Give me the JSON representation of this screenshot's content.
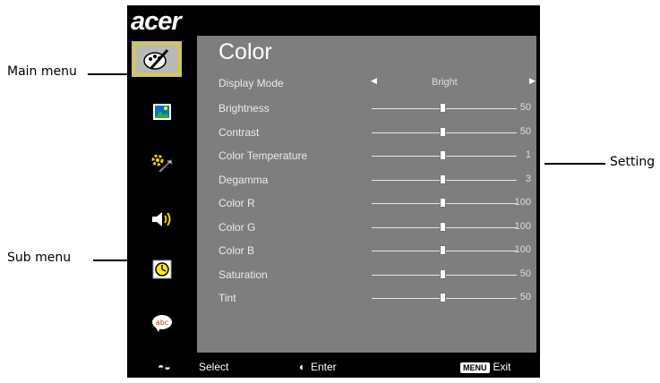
{
  "callouts": {
    "main_menu": "Main menu",
    "sub_menu": "Sub menu",
    "setting": "Setting"
  },
  "osd": {
    "logo": "acer",
    "sidebar": [
      "color-icon",
      "image-icon",
      "settings-icon",
      "audio-icon",
      "timer-icon",
      "language-icon"
    ],
    "title": "Color",
    "display_mode": {
      "label": "Display Mode",
      "value": "Bright"
    },
    "rows": [
      {
        "label": "Brightness",
        "value": "50"
      },
      {
        "label": "Contrast",
        "value": "50"
      },
      {
        "label": "Color Temperature",
        "value": "1"
      },
      {
        "label": "Degamma",
        "value": "3"
      },
      {
        "label": "Color R",
        "value": "100"
      },
      {
        "label": "Color G",
        "value": "100"
      },
      {
        "label": "Color B",
        "value": "100"
      },
      {
        "label": "Saturation",
        "value": "50"
      },
      {
        "label": "Tint",
        "value": "50"
      }
    ],
    "footer": {
      "select": "Select",
      "enter": "Enter",
      "menu_key": "MENU",
      "exit": "Exit"
    },
    "colors": {
      "accent": "#e4d000",
      "panel": "#7e7e7e",
      "sidebar": "#000000"
    }
  }
}
